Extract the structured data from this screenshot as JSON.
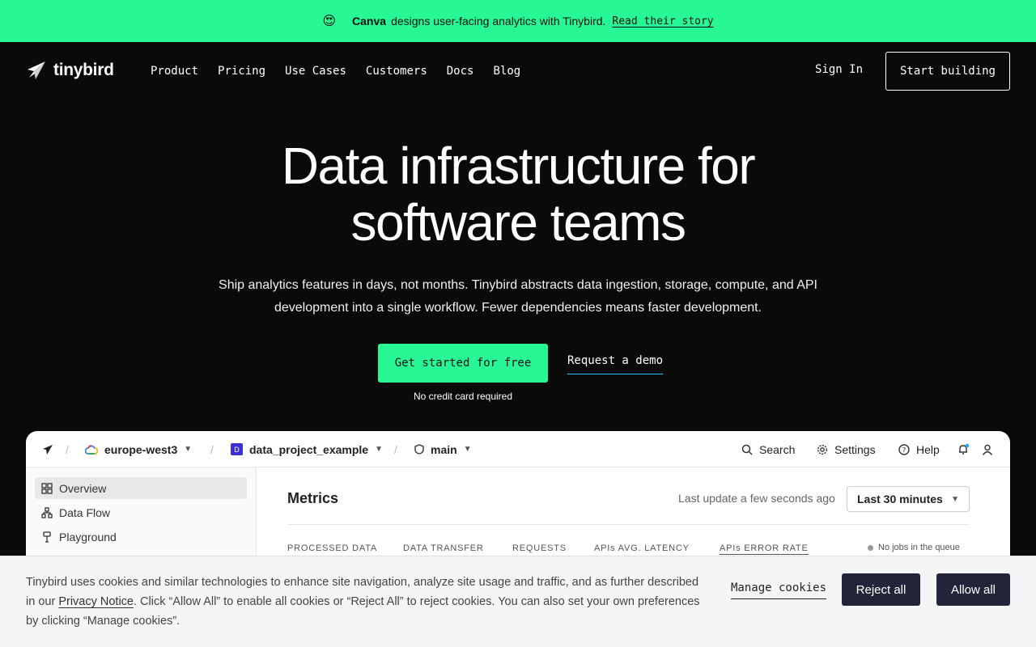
{
  "announcement": {
    "emoji": "😍",
    "brand": "Canva",
    "text": "designs user-facing analytics with Tinybird.",
    "link": "Read their story"
  },
  "nav": {
    "logo_text": "tinybird",
    "links": [
      "Product",
      "Pricing",
      "Use Cases",
      "Customers",
      "Docs",
      "Blog"
    ],
    "sign_in": "Sign In",
    "start_building": "Start building"
  },
  "hero": {
    "title_line1": "Data infrastructure for",
    "title_line2": "software teams",
    "subtitle": "Ship analytics features in days, not months. Tinybird abstracts data ingestion, storage, compute, and API development into a single workflow. Fewer dependencies means faster development.",
    "cta_primary": "Get started for free",
    "cta_secondary": "Request a demo",
    "note": "No credit card required"
  },
  "app_preview": {
    "region": "europe-west3",
    "project_badge": "D",
    "project": "data_project_example",
    "branch": "main",
    "search": "Search",
    "settings": "Settings",
    "help": "Help",
    "sidebar": [
      "Overview",
      "Data Flow",
      "Playground"
    ],
    "metrics_title": "Metrics",
    "last_update": "Last update a few seconds ago",
    "time_range": "Last 30 minutes",
    "columns": [
      "PROCESSED DATA",
      "DATA TRANSFER",
      "REQUESTS",
      "APIs AVG. LATENCY",
      "APIs ERROR RATE"
    ],
    "jobs_status": "No jobs in the queue"
  },
  "cookie": {
    "text_before": "Tinybird uses cookies and similar technologies to enhance site navigation, analyze site usage and traffic, and as further described in our ",
    "privacy_link": "Privacy Notice",
    "text_after": ". Click “Allow All” to enable all cookies or “Reject All” to reject cookies. You can also set your own preferences by clicking “Manage cookies”.",
    "manage": "Manage cookies",
    "reject": "Reject all",
    "allow": "Allow all"
  },
  "colors": {
    "accent": "#27f795",
    "background": "#0a0a0a",
    "cookie_button": "#23243a"
  }
}
